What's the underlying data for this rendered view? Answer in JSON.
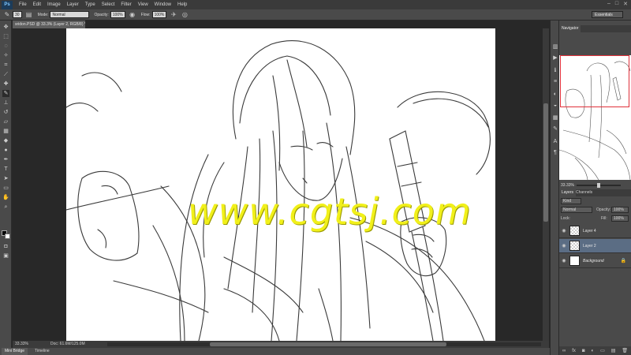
{
  "app": {
    "logo": "Ps",
    "menu": [
      "File",
      "Edit",
      "Image",
      "Layer",
      "Type",
      "Select",
      "Filter",
      "View",
      "Window",
      "Help"
    ],
    "window_controls": [
      "–",
      "□",
      "✕"
    ]
  },
  "options_bar": {
    "brush_size": "30",
    "mode_label": "Mode:",
    "mode_value": "Normal",
    "opacity_label": "Opacity:",
    "opacity_value": "100%",
    "flow_label": "Flow:",
    "flow_value": "100%",
    "workspace": "Essentials"
  },
  "document": {
    "tab_title": "sridon.PSD @ 33.3% (Layer 2, RGB/8) *",
    "zoom": "33.33%",
    "doc_size": "Doc: 61.6M/125.0M"
  },
  "bottom_tabs": [
    "Mini Bridge",
    "Timeline"
  ],
  "navigator": {
    "tab": "Navigator",
    "zoom": "33.33%"
  },
  "layers_panel": {
    "tabs": [
      "Layers",
      "Channels"
    ],
    "filter_kind": "Kind",
    "blend_mode": "Normal",
    "opacity_label": "Opacity:",
    "opacity_value": "100%",
    "lock_label": "Lock:",
    "fill_label": "Fill:",
    "fill_value": "100%",
    "layers": [
      {
        "name": "Layer 4",
        "selected": false
      },
      {
        "name": "Layer 2",
        "selected": true
      },
      {
        "name": "Background",
        "selected": false,
        "locked": true
      }
    ]
  },
  "watermark": "www.cgtsj.com",
  "colors": {
    "ui_dark": "#282828",
    "panel": "#4a4a4a",
    "selection": "#5b6d84",
    "nav_box": "#e0303a",
    "watermark": "#f1f01a"
  }
}
